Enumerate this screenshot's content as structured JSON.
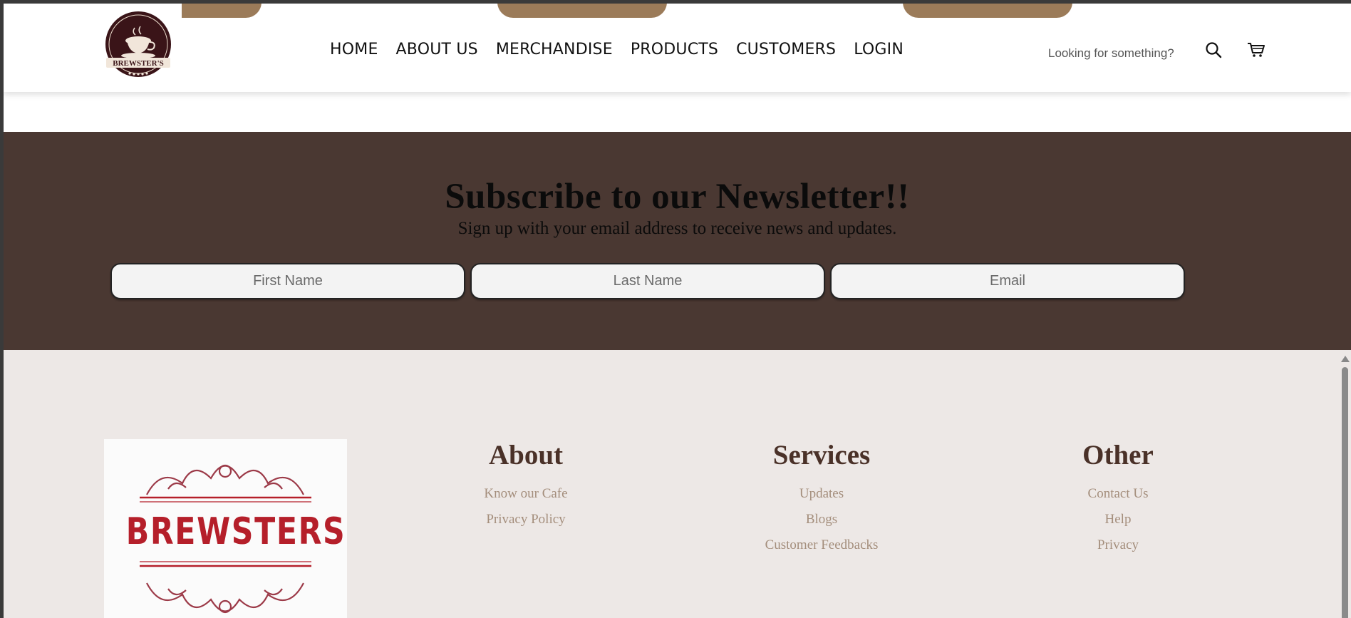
{
  "header": {
    "brand": "BREWSTER'S",
    "nav": [
      "HOME",
      "ABOUT US",
      "MERCHANDISE",
      "PRODUCTS",
      "CUSTOMERS",
      "LOGIN"
    ],
    "search_placeholder": "Looking for something?",
    "icons": [
      "search-icon",
      "cart-icon"
    ]
  },
  "newsletter": {
    "title": "Subscribe to our Newsletter!!",
    "subtitle": "Sign up with your email address to receive news and updates.",
    "first_name_placeholder": "First Name",
    "last_name_placeholder": "Last Name",
    "email_placeholder": "Email"
  },
  "footer": {
    "logo_text": "BREWSTERS",
    "about": {
      "heading": "About",
      "links": [
        "Know our Cafe",
        "Privacy Policy"
      ]
    },
    "services": {
      "heading": "Services",
      "links": [
        "Updates",
        "Blogs",
        "Customer Feedbacks"
      ]
    },
    "other": {
      "heading": "Other",
      "links": [
        "Contact Us",
        "Help",
        "Privacy"
      ]
    }
  },
  "colors": {
    "newsletter_bg": "#4a3832",
    "footer_bg": "#ede8e6",
    "footer_heading": "#4a3128",
    "footer_link": "#a48e7c",
    "accent_tan": "#9b7b59",
    "logo_red": "#b51f2a"
  }
}
